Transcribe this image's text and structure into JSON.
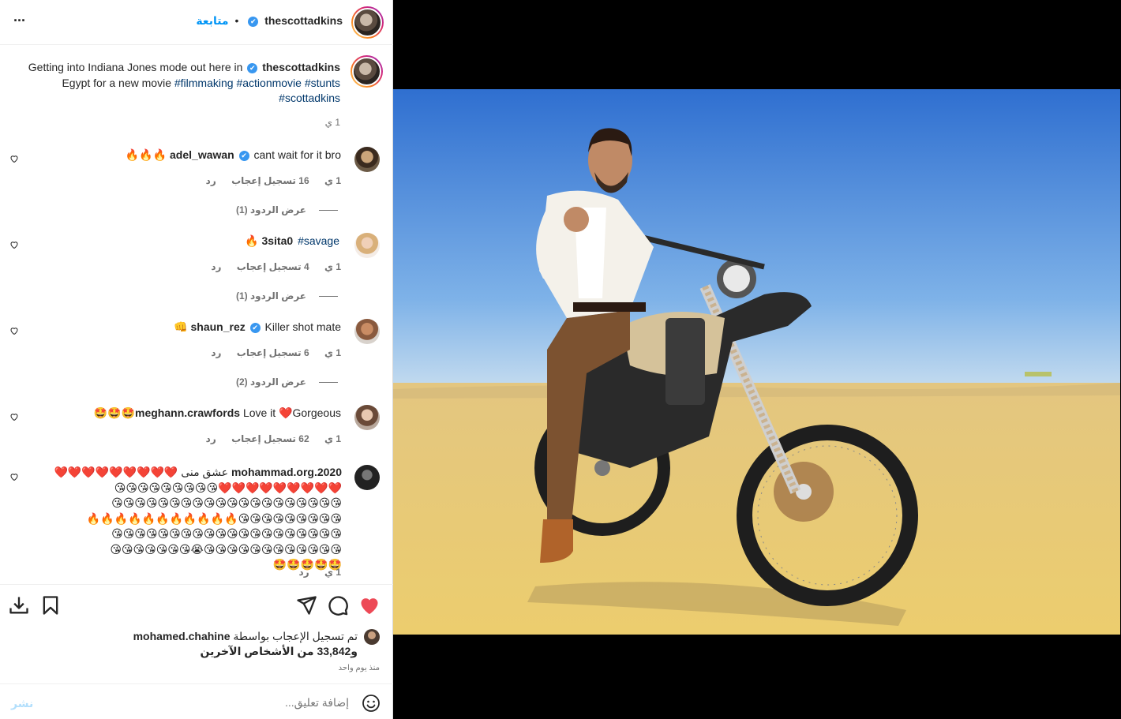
{
  "header": {
    "username": "thescottadkins",
    "verified_mark": "✔",
    "separator": "•",
    "follow_label": "متابعة",
    "more_label": "···"
  },
  "caption": {
    "username": "thescottadkins",
    "line1": "Getting into Indiana Jones mode out here in",
    "line2": "Egypt for a new movie",
    "hashtags_line2": [
      "#filmmaking",
      "#actionmovie",
      "#stunts"
    ],
    "hashtags_line3": [
      "#scottadkins"
    ],
    "time": "1 ي"
  },
  "comments": [
    {
      "username": "adel_wawan",
      "verified": true,
      "text": "cant wait for it bro 🔥🔥🔥",
      "time": "1 ي",
      "likes": "16 تسجيل إعجاب",
      "reply": "رد",
      "view_replies": "عرض الردود (1)"
    },
    {
      "username": "3sita0",
      "verified": false,
      "text_hashtag": "#savage",
      "text_emoji": "🔥",
      "time": "1 ي",
      "likes": "4 تسجيل إعجاب",
      "reply": "رد",
      "view_replies": "عرض الردود (1)"
    },
    {
      "username": "shaun_rez",
      "verified": true,
      "text": "Killer shot mate 👊",
      "time": "1 ي",
      "likes": "6 تسجيل إعجاب",
      "reply": "رد",
      "view_replies": "عرض الردود (2)"
    },
    {
      "username": "meghann.crawfords",
      "verified": false,
      "text": "Love it ❤️Gorgeous🤩🤩🤩",
      "time": "1 ي",
      "likes": "62 تسجيل إعجاب",
      "reply": "رد"
    },
    {
      "username": "mohammad.org.2020",
      "verified": false,
      "text_lines": [
        "عشق منى ❤️❤️❤️❤️❤️❤️❤️❤️❤️",
        "❤️❤️❤️❤️❤️❤️❤️❤️❤️😘😘😘😘😘😘😘😘😘",
        "😘😘😘😘😘😘😘😘😘😘😘😘😘😘😘😘😘😘😘😘",
        "😘😘😘😘😘😘😘😘😘🔥🔥🔥🔥🔥🔥🔥🔥🔥🔥🔥",
        "😘😘😘😘😘😘😘😘😘😘😘😘😘😘😘😘😘😘😘😘",
        "😘😘😘😘😘😘😘😘😘😘😘😘😭😘😘😘😘😘😘😘",
        "🤩🤩🤩🤩🤩"
      ],
      "time": "1 ي",
      "reply": "رد"
    }
  ],
  "actions": {
    "liked_by_prefix": "تم تسجيل الإعجاب بواسطة",
    "liked_by_user": "mohamed.chahine",
    "others": "و33,842 من الأشخاص الآخرين",
    "post_time": "منذ يوم واحد"
  },
  "add_comment": {
    "placeholder": "إضافة تعليق...",
    "post_label": "نشر"
  },
  "colors": {
    "like_red": "#ed4956",
    "verified_blue": "#3897f0",
    "follow_blue": "#0095f6",
    "hashtag": "#00376b",
    "muted": "#737373"
  }
}
